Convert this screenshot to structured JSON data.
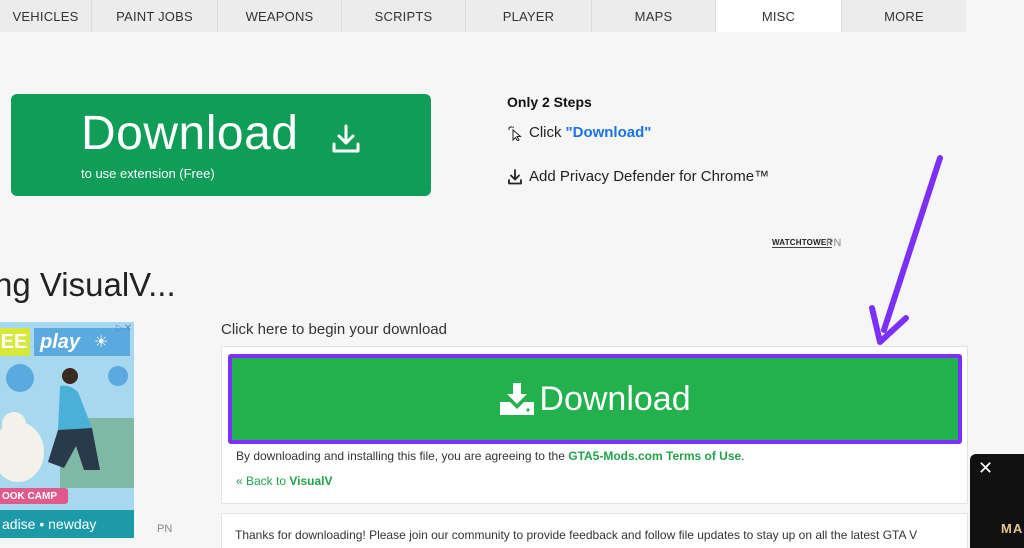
{
  "nav": {
    "items": [
      {
        "label": "VEHICLES",
        "active": false
      },
      {
        "label": "PAINT JOBS",
        "active": false
      },
      {
        "label": "WEAPONS",
        "active": false
      },
      {
        "label": "SCRIPTS",
        "active": false
      },
      {
        "label": "PLAYER",
        "active": false
      },
      {
        "label": "MAPS",
        "active": false
      },
      {
        "label": "MISC",
        "active": true
      },
      {
        "label": "MORE",
        "active": false
      }
    ]
  },
  "ad": {
    "download_label": "Download",
    "download_sub": "to use extension (Free)",
    "steps_title": "Only 2 Steps",
    "step1_prefix": "Click",
    "step1_link": "\"Download\"",
    "step2": "Add Privacy Defender for Chrome™",
    "watchtower": "WATCHTOWER",
    "pn": "PN",
    "color": "#0f9d58"
  },
  "page": {
    "title": "ng VisualV..."
  },
  "side_ad": {
    "tag_ee": "EE",
    "tag_play": "play",
    "camp": "OOK CAMP",
    "brand": "adise • newday",
    "pn": "PN"
  },
  "download": {
    "prompt": "Click here to begin your download",
    "button_label": "Download",
    "agree_prefix": "By downloading and installing this file, you are agreeing to the",
    "agree_site": "GTA5-Mods.com",
    "agree_terms": "Terms of Use",
    "agree_suffix": ".",
    "back_prefix": "« Back to",
    "back_target": "VisualV",
    "button_color": "#22b14c",
    "highlight_color": "#7b2ff7"
  },
  "thanks": {
    "text": "Thanks for downloading! Please join our community to provide feedback and follow file updates to stay up on all the latest GTA V"
  },
  "popup": {
    "close": "✕",
    "text": "MA"
  }
}
